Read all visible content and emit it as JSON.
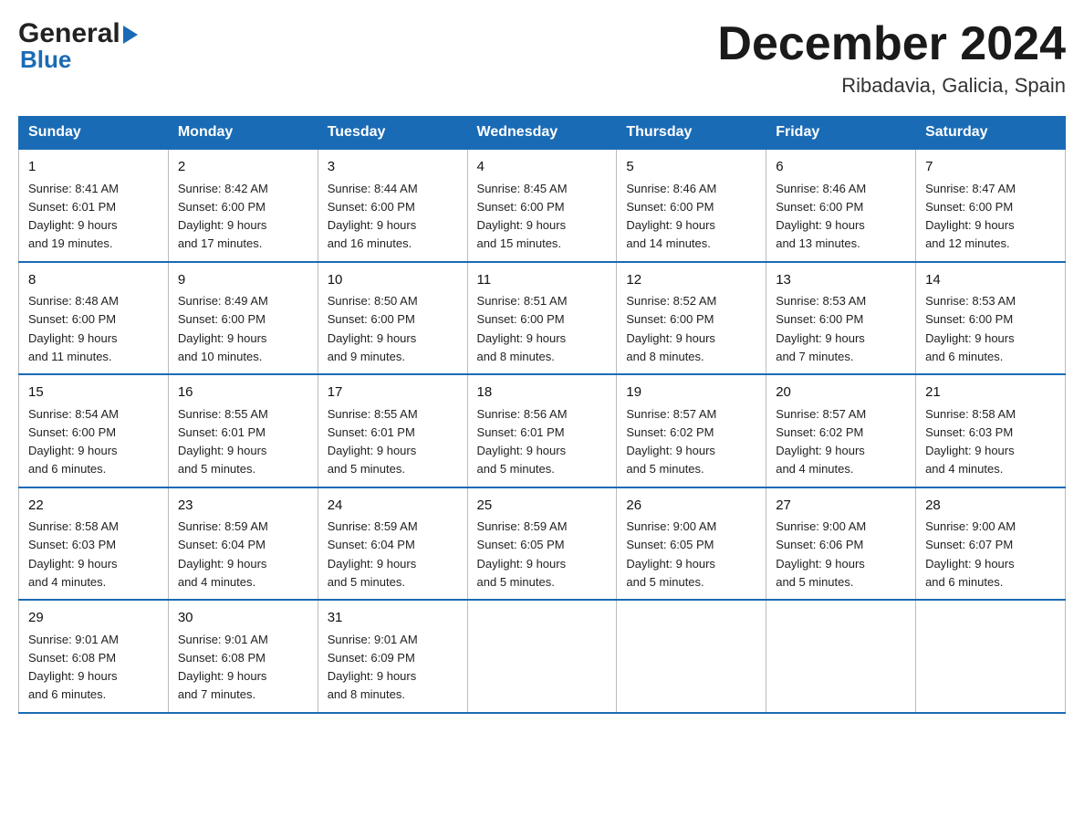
{
  "header": {
    "logo_general": "General",
    "logo_blue": "Blue",
    "month_title": "December 2024",
    "location": "Ribadavia, Galicia, Spain"
  },
  "weekdays": [
    "Sunday",
    "Monday",
    "Tuesday",
    "Wednesday",
    "Thursday",
    "Friday",
    "Saturday"
  ],
  "weeks": [
    [
      {
        "day": "1",
        "sunrise": "8:41 AM",
        "sunset": "6:01 PM",
        "daylight": "9 hours and 19 minutes."
      },
      {
        "day": "2",
        "sunrise": "8:42 AM",
        "sunset": "6:00 PM",
        "daylight": "9 hours and 17 minutes."
      },
      {
        "day": "3",
        "sunrise": "8:44 AM",
        "sunset": "6:00 PM",
        "daylight": "9 hours and 16 minutes."
      },
      {
        "day": "4",
        "sunrise": "8:45 AM",
        "sunset": "6:00 PM",
        "daylight": "9 hours and 15 minutes."
      },
      {
        "day": "5",
        "sunrise": "8:46 AM",
        "sunset": "6:00 PM",
        "daylight": "9 hours and 14 minutes."
      },
      {
        "day": "6",
        "sunrise": "8:46 AM",
        "sunset": "6:00 PM",
        "daylight": "9 hours and 13 minutes."
      },
      {
        "day": "7",
        "sunrise": "8:47 AM",
        "sunset": "6:00 PM",
        "daylight": "9 hours and 12 minutes."
      }
    ],
    [
      {
        "day": "8",
        "sunrise": "8:48 AM",
        "sunset": "6:00 PM",
        "daylight": "9 hours and 11 minutes."
      },
      {
        "day": "9",
        "sunrise": "8:49 AM",
        "sunset": "6:00 PM",
        "daylight": "9 hours and 10 minutes."
      },
      {
        "day": "10",
        "sunrise": "8:50 AM",
        "sunset": "6:00 PM",
        "daylight": "9 hours and 9 minutes."
      },
      {
        "day": "11",
        "sunrise": "8:51 AM",
        "sunset": "6:00 PM",
        "daylight": "9 hours and 8 minutes."
      },
      {
        "day": "12",
        "sunrise": "8:52 AM",
        "sunset": "6:00 PM",
        "daylight": "9 hours and 8 minutes."
      },
      {
        "day": "13",
        "sunrise": "8:53 AM",
        "sunset": "6:00 PM",
        "daylight": "9 hours and 7 minutes."
      },
      {
        "day": "14",
        "sunrise": "8:53 AM",
        "sunset": "6:00 PM",
        "daylight": "9 hours and 6 minutes."
      }
    ],
    [
      {
        "day": "15",
        "sunrise": "8:54 AM",
        "sunset": "6:00 PM",
        "daylight": "9 hours and 6 minutes."
      },
      {
        "day": "16",
        "sunrise": "8:55 AM",
        "sunset": "6:01 PM",
        "daylight": "9 hours and 5 minutes."
      },
      {
        "day": "17",
        "sunrise": "8:55 AM",
        "sunset": "6:01 PM",
        "daylight": "9 hours and 5 minutes."
      },
      {
        "day": "18",
        "sunrise": "8:56 AM",
        "sunset": "6:01 PM",
        "daylight": "9 hours and 5 minutes."
      },
      {
        "day": "19",
        "sunrise": "8:57 AM",
        "sunset": "6:02 PM",
        "daylight": "9 hours and 5 minutes."
      },
      {
        "day": "20",
        "sunrise": "8:57 AM",
        "sunset": "6:02 PM",
        "daylight": "9 hours and 4 minutes."
      },
      {
        "day": "21",
        "sunrise": "8:58 AM",
        "sunset": "6:03 PM",
        "daylight": "9 hours and 4 minutes."
      }
    ],
    [
      {
        "day": "22",
        "sunrise": "8:58 AM",
        "sunset": "6:03 PM",
        "daylight": "9 hours and 4 minutes."
      },
      {
        "day": "23",
        "sunrise": "8:59 AM",
        "sunset": "6:04 PM",
        "daylight": "9 hours and 4 minutes."
      },
      {
        "day": "24",
        "sunrise": "8:59 AM",
        "sunset": "6:04 PM",
        "daylight": "9 hours and 5 minutes."
      },
      {
        "day": "25",
        "sunrise": "8:59 AM",
        "sunset": "6:05 PM",
        "daylight": "9 hours and 5 minutes."
      },
      {
        "day": "26",
        "sunrise": "9:00 AM",
        "sunset": "6:05 PM",
        "daylight": "9 hours and 5 minutes."
      },
      {
        "day": "27",
        "sunrise": "9:00 AM",
        "sunset": "6:06 PM",
        "daylight": "9 hours and 5 minutes."
      },
      {
        "day": "28",
        "sunrise": "9:00 AM",
        "sunset": "6:07 PM",
        "daylight": "9 hours and 6 minutes."
      }
    ],
    [
      {
        "day": "29",
        "sunrise": "9:01 AM",
        "sunset": "6:08 PM",
        "daylight": "9 hours and 6 minutes."
      },
      {
        "day": "30",
        "sunrise": "9:01 AM",
        "sunset": "6:08 PM",
        "daylight": "9 hours and 7 minutes."
      },
      {
        "day": "31",
        "sunrise": "9:01 AM",
        "sunset": "6:09 PM",
        "daylight": "9 hours and 8 minutes."
      },
      null,
      null,
      null,
      null
    ]
  ],
  "labels": {
    "sunrise": "Sunrise:",
    "sunset": "Sunset:",
    "daylight": "Daylight:"
  }
}
